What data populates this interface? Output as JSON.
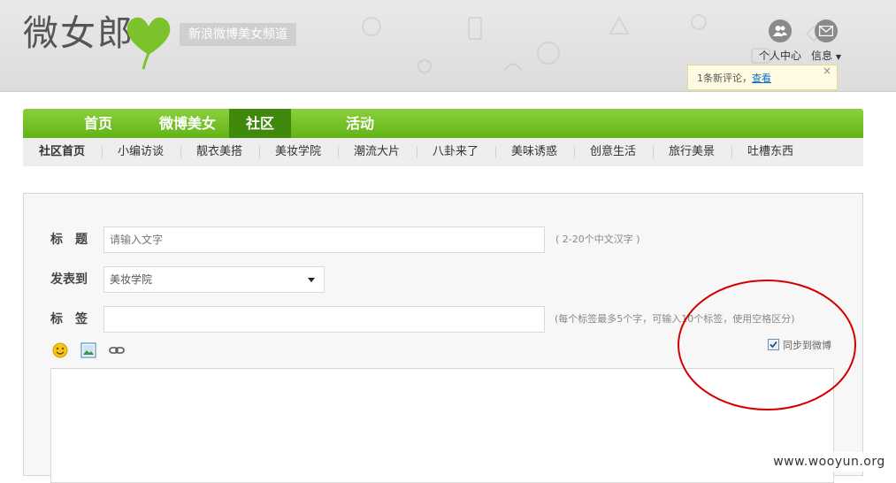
{
  "header": {
    "logo_text": "微女郎",
    "slogan": "新浪微博美女频道",
    "profile_label": "个人中心",
    "messages_label": "信息",
    "notification": {
      "text": "1条新评论，",
      "link": "查看",
      "close": "×"
    }
  },
  "nav": {
    "items": [
      {
        "label": "首页"
      },
      {
        "label": "微博美女"
      },
      {
        "label": "社区",
        "active": true
      },
      {
        "label": "活动"
      }
    ]
  },
  "subnav": {
    "items": [
      {
        "label": "社区首页",
        "active": true
      },
      {
        "label": "小编访谈"
      },
      {
        "label": "靓衣美搭"
      },
      {
        "label": "美妆学院"
      },
      {
        "label": "潮流大片"
      },
      {
        "label": "八卦来了"
      },
      {
        "label": "美味诱惑"
      },
      {
        "label": "创意生活"
      },
      {
        "label": "旅行美景"
      },
      {
        "label": "吐槽东西"
      }
    ]
  },
  "form": {
    "title_label": "标　题",
    "title_placeholder": "请输入文字",
    "title_hint": "( 2-20个中文汉字 )",
    "publish_label": "发表到",
    "publish_value": "美妆学院",
    "tags_label": "标　签",
    "tags_value": "",
    "tags_hint": "(每个标签最多5个字，可输入10个标签，使用空格区分)",
    "sync_label": "同步到微博",
    "sync_checked": true,
    "toolbar": {
      "emoji_icon": "emoji-icon",
      "image_icon": "image-icon",
      "link_icon": "link-icon"
    }
  },
  "watermark": "www.wooyun.org",
  "colors": {
    "nav_green": "#6fbe22",
    "nav_active": "#3f8a0c",
    "annotation_red": "#d40000"
  }
}
